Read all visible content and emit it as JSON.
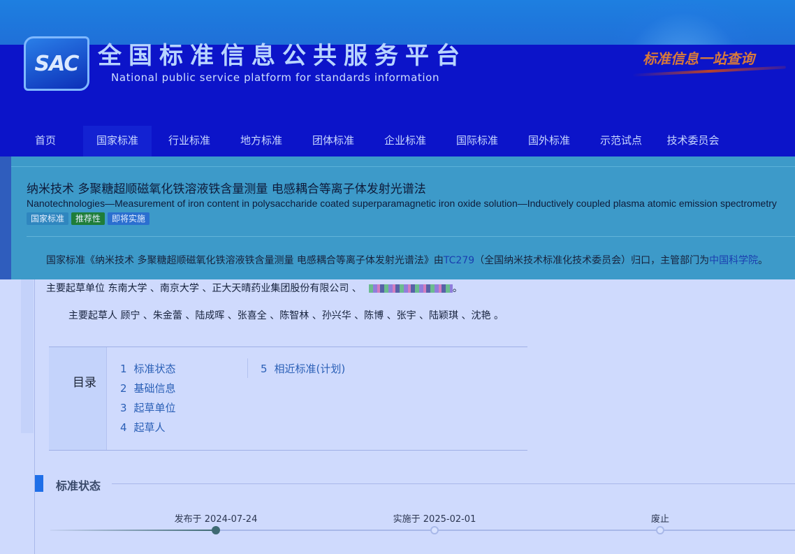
{
  "header": {
    "logo_text": "SAC",
    "title": "全国标准信息公共服务平台",
    "subtitle": "National public service platform  for standards information",
    "slogan": "标准信息一站查询"
  },
  "nav": {
    "items": [
      {
        "label": "首页"
      },
      {
        "label": "国家标准"
      },
      {
        "label": "行业标准"
      },
      {
        "label": "地方标准"
      },
      {
        "label": "团体标准"
      },
      {
        "label": "企业标准"
      },
      {
        "label": "国际标准"
      },
      {
        "label": "国外标准"
      },
      {
        "label": "示范试点"
      },
      {
        "label": "技术委员会"
      }
    ],
    "active": "国家标准"
  },
  "standard": {
    "title_cn": "纳米技术 多聚糖超顺磁氧化铁溶液铁含量测量 电感耦合等离子体发射光谱法",
    "title_en": "Nanotechnologies—Measurement of iron content in polysaccharide coated superparamagnetic iron oxide solution—Inductively coupled plasma atomic emission spectrometry",
    "badges": [
      "国家标准",
      "推荐性",
      "即将实施"
    ]
  },
  "info": {
    "line1_prefix": "国家标准《纳米技术 多聚糖超顺磁氧化铁溶液铁含量测量 电感耦合等离子体发射光谱法》由",
    "tc_code": "TC279",
    "tc_name": "（全国纳米技术标准化技术委员会）归口，主管部门为",
    "dept": "中国科学院",
    "dept_end": "。",
    "line2": "主要起草单位 东南大学 、南京大学 、正大天晴药业集团股份有限公司 、",
    "line2_end": "。",
    "line3": "主要起草人 顾宁 、朱金蕾 、陆成晖 、张喜全 、陈智林 、孙兴华 、陈博 、张宇 、陆颖琪 、沈艳 。"
  },
  "toc": {
    "heading": "目录",
    "items": [
      {
        "num": "1",
        "label": "标准状态"
      },
      {
        "num": "2",
        "label": "基础信息"
      },
      {
        "num": "3",
        "label": "起草单位"
      },
      {
        "num": "4",
        "label": "起草人"
      },
      {
        "num": "5",
        "label": "相近标准(计划)"
      }
    ]
  },
  "status_section": {
    "title": "标准状态",
    "timeline": [
      {
        "label": "发布于 2024-07-24",
        "done": true
      },
      {
        "label": "实施于 2025-02-01",
        "done": false
      },
      {
        "label": "废止",
        "done": false
      }
    ]
  },
  "colors": {
    "header_blue": "#0c14c9",
    "panel_blue": "#3d9ac9",
    "page_bg": "#cfdafd",
    "link": "#1a3fb0",
    "badge_green": "#1e7d39"
  }
}
